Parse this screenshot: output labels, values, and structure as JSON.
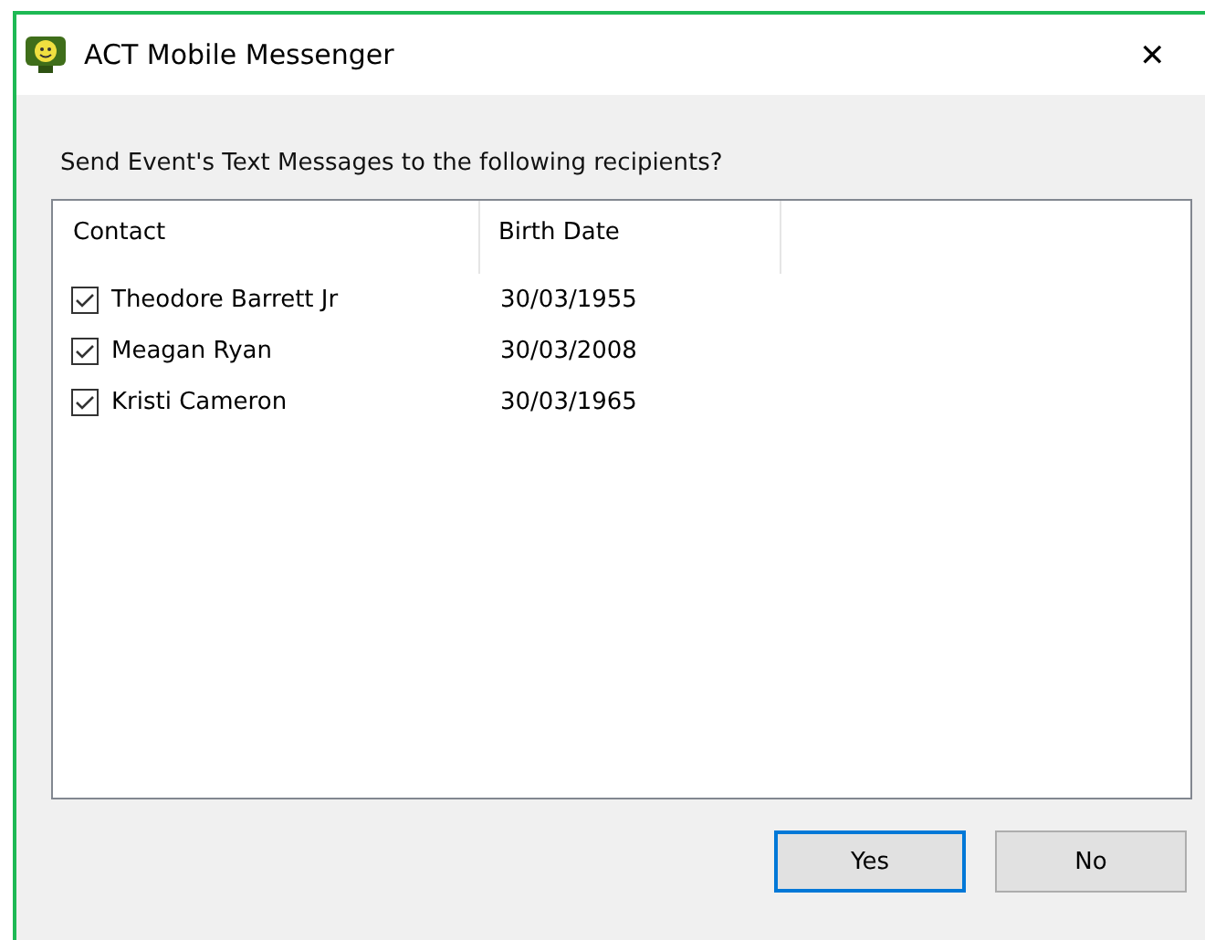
{
  "window": {
    "title": "ACT Mobile Messenger",
    "close": "✕"
  },
  "prompt": "Send Event's Text Messages to the following recipients?",
  "table": {
    "columns": [
      "Contact",
      "Birth Date"
    ],
    "rows": [
      {
        "contact": "Theodore Barrett Jr",
        "birth_date": "30/03/1955",
        "checked": true
      },
      {
        "contact": "Meagan Ryan",
        "birth_date": "30/03/2008",
        "checked": true
      },
      {
        "contact": "Kristi Cameron",
        "birth_date": "30/03/1965",
        "checked": true
      }
    ]
  },
  "buttons": [
    {
      "label": "Yes",
      "default": true
    },
    {
      "label": "No",
      "default": false
    }
  ]
}
